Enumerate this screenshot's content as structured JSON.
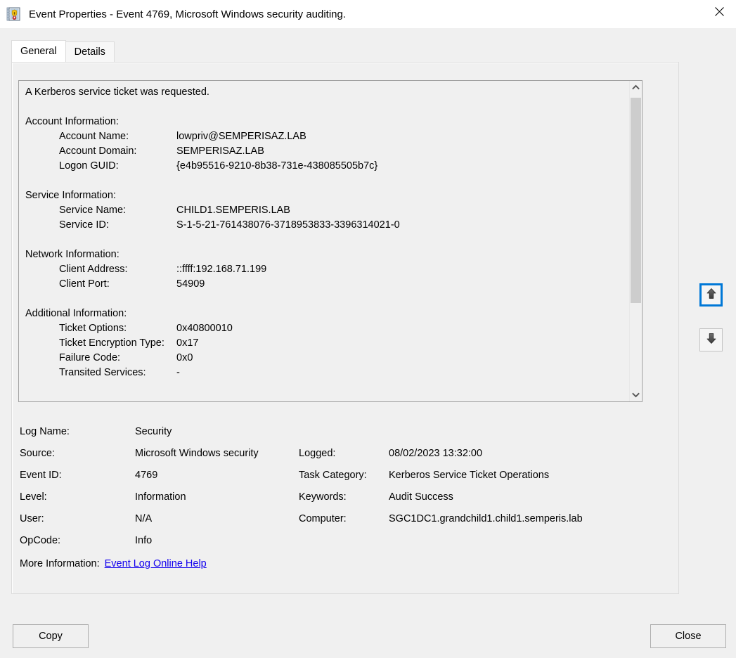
{
  "window": {
    "title": "Event Properties - Event 4769, Microsoft Windows security auditing.",
    "icon": "event-log-icon",
    "close_icon": "close-icon"
  },
  "tabs": [
    {
      "label": "General",
      "active": true
    },
    {
      "label": "Details",
      "active": false
    }
  ],
  "description": {
    "summary": "A Kerberos service ticket was requested.",
    "sections": [
      {
        "heading": "Account Information:",
        "fields": [
          {
            "label": "Account Name:",
            "value": "lowpriv@SEMPERISAZ.LAB"
          },
          {
            "label": "Account Domain:",
            "value": "SEMPERISAZ.LAB"
          },
          {
            "label": "Logon GUID:",
            "value": "{e4b95516-9210-8b38-731e-438085505b7c}"
          }
        ]
      },
      {
        "heading": "Service Information:",
        "fields": [
          {
            "label": "Service Name:",
            "value": "CHILD1.SEMPERIS.LAB"
          },
          {
            "label": "Service ID:",
            "value": "S-1-5-21-761438076-3718953833-3396314021-0"
          }
        ]
      },
      {
        "heading": "Network Information:",
        "fields": [
          {
            "label": "Client Address:",
            "value": "::ffff:192.168.71.199"
          },
          {
            "label": "Client Port:",
            "value": "54909"
          }
        ]
      },
      {
        "heading": "Additional Information:",
        "fields": [
          {
            "label": "Ticket Options:",
            "value": "0x40800010"
          },
          {
            "label": "Ticket Encryption Type:",
            "value": "0x17"
          },
          {
            "label": "Failure Code:",
            "value": "0x0"
          },
          {
            "label": "Transited Services:",
            "value": "-"
          }
        ]
      }
    ]
  },
  "scrollbar": {
    "up_icon": "chevron-up-icon",
    "down_icon": "chevron-down-icon"
  },
  "details": {
    "rows": [
      {
        "label_a": "Log Name:",
        "value_a": "Security",
        "label_b": "",
        "value_b": ""
      },
      {
        "label_a": "Source:",
        "value_a": "Microsoft Windows security",
        "label_b": "Logged:",
        "value_b": "08/02/2023 13:32:00"
      },
      {
        "label_a": "Event ID:",
        "value_a": "4769",
        "label_b": "Task Category:",
        "value_b": "Kerberos Service Ticket Operations"
      },
      {
        "label_a": "Level:",
        "value_a": "Information",
        "label_b": "Keywords:",
        "value_b": "Audit Success"
      },
      {
        "label_a": "User:",
        "value_a": "N/A",
        "label_b": "Computer:",
        "value_b": "SGC1DC1.grandchild1.child1.semperis.lab"
      },
      {
        "label_a": "OpCode:",
        "value_a": "Info",
        "label_b": "",
        "value_b": ""
      }
    ],
    "more_information_label": "More Information:",
    "more_information_link": "Event Log Online Help"
  },
  "nav_buttons": {
    "previous_icon": "arrow-up-icon",
    "next_icon": "arrow-down-icon"
  },
  "buttons": {
    "copy": "Copy",
    "close": "Close"
  },
  "colors": {
    "focus_ring": "#0078d7",
    "link": "#1200ee",
    "dialog_background": "#f0f0f0",
    "scrollbar_thumb": "#cdcdcd"
  }
}
